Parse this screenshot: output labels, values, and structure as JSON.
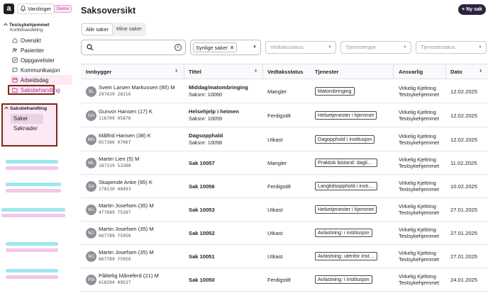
{
  "app": {
    "logo_letter": "a",
    "notifications_label": "Varslinger",
    "demo_badge": "Demo"
  },
  "sidebar": {
    "org_name": "Testsykehjemmet",
    "org_unit": "Korttidsavdeling",
    "items": [
      {
        "label": "Oversikt",
        "icon": "home-icon"
      },
      {
        "label": "Pasienter",
        "icon": "users-icon"
      },
      {
        "label": "Oppgavelister",
        "icon": "checklist-icon"
      },
      {
        "label": "Kommunikasjon",
        "icon": "chat-icon"
      },
      {
        "label": "Arbeidsdag",
        "icon": "calendar-icon"
      },
      {
        "label": "Saksbehandling",
        "icon": "folder-icon"
      }
    ],
    "section": {
      "title": "Saksbehandling",
      "items": [
        {
          "label": "Saker"
        },
        {
          "label": "Søknader"
        }
      ]
    }
  },
  "header": {
    "title": "Saksoversikt",
    "new_button": "Ny sak"
  },
  "tabs": [
    {
      "label": "Alle saker"
    },
    {
      "label": "Mine saker"
    }
  ],
  "filters": {
    "search_placeholder": "",
    "chip": "Synlige saker",
    "vedtaksstatus": "Vedtaksstatus",
    "tjenestetype": "Tjenestetype",
    "tjenestestatus": "Tjenestestatus"
  },
  "table": {
    "columns": [
      "Innbygger",
      "Tittel",
      "Vedtaksstatus",
      "Tjenester",
      "Ansvarlig",
      "Dato"
    ],
    "rows": [
      {
        "initials": "SL",
        "name": "Svein Larsen Markussen (85) M",
        "ssn": "297439 28316",
        "title": "Middag/matombringing",
        "saksnr": "Saksnr: 10060",
        "status": "Mangler",
        "service": "Matombringing",
        "resp1": "Virkelig Kjeltring",
        "resp2": "Testsykehjemmet",
        "date": "12.02.2025"
      },
      {
        "initials": "GH",
        "name": "Gunvor Hansen (17) K",
        "ssn": "116709 95876",
        "title": "Helsehjelp i heimen",
        "saksnr": "Saksnr: 10059",
        "status": "Ferdigstilt",
        "service": "Helsetjenester i hjemmet",
        "resp1": "Virkelig Kjeltring",
        "resp2": "Testsykehjemmet",
        "date": "12.02.2025"
      },
      {
        "initials": "MH",
        "name": "Målfrid Hansen (38) K",
        "ssn": "057386 97067",
        "title": "Dagsopphald",
        "saksnr": "Saksnr: 10058",
        "status": "Utkast",
        "service": "Dagopphold i institusjon",
        "resp1": "Virkelig Kjeltring",
        "resp2": "Testsykehjemmet",
        "date": "12.02.2025"
      },
      {
        "initials": "ML",
        "name": "Martin Lien (5) M",
        "ssn": "187319 53380",
        "title": "Sak 10057",
        "saksnr": "",
        "status": "Mangler",
        "service": "Praktisk bistand: daglige…",
        "resp1": "Virkelig Kjeltring",
        "resp2": "Testsykehjemmet",
        "date": "11.02.2025"
      },
      {
        "initials": "SA",
        "name": "Skapende Anke (95) K",
        "ssn": "178130 48493",
        "title": "Sak 10056",
        "saksnr": "",
        "status": "Ferdigstilt",
        "service": "Langtidsopphold i institu…",
        "resp1": "Virkelig Kjeltring",
        "resp2": "Testsykehjemmet",
        "date": "10.02.2025"
      },
      {
        "initials": "MJ",
        "name": "Martin Josefsen (35) M",
        "ssn": "477689 75287",
        "title": "Sak 10053",
        "saksnr": "",
        "status": "Utkast",
        "service": "Helsetjenester i hjemmet",
        "resp1": "Virkelig Kjeltring",
        "resp2": "Testsykehjemmet",
        "date": "27.01.2025"
      },
      {
        "initials": "MJ",
        "name": "Martin Josefsen (35) M",
        "ssn": "667789 75956",
        "title": "Sak 10052",
        "saksnr": "",
        "status": "Utkast",
        "service": "Avlastning: i institusjon",
        "resp1": "Virkelig Kjeltring",
        "resp2": "Testsykehjemmet",
        "date": "27.01.2025"
      },
      {
        "initials": "MJ",
        "name": "Martin Josefsen (35) M",
        "ssn": "667789 75956",
        "title": "Sak 10051",
        "saksnr": "",
        "status": "Utkast",
        "service": "Avlastning: utenfor instit…",
        "resp1": "Virkelig Kjeltring",
        "resp2": "Testsykehjemmet",
        "date": "27.01.2025"
      },
      {
        "initials": "PM",
        "name": "Pålitelig Måneferd (21) M",
        "ssn": "018204 09537",
        "title": "Sak 10050",
        "saksnr": "",
        "status": "Ferdigstilt",
        "service": "Avlastning: i institusjon",
        "resp1": "Virkelig Kjeltring",
        "resp2": "Testsykehjemmet",
        "date": "24.01.2025"
      }
    ]
  },
  "colors": {
    "accent": "#b3368e",
    "accent_bg": "#fde8f5",
    "highlight_border": "#7a2b1a",
    "primary_button": "#2c2342"
  }
}
